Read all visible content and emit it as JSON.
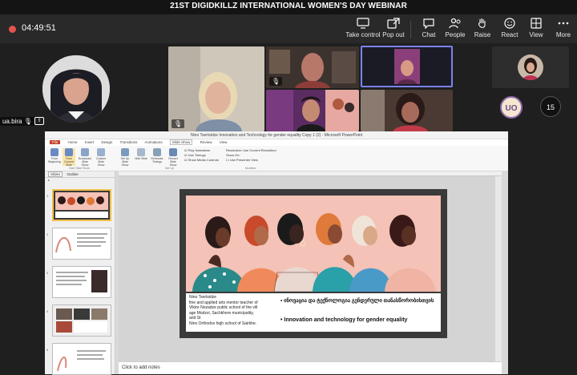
{
  "window": {
    "title": "21ST DIGIDKILLZ INTERNATIONAL WOMEN'S DAY WEBINAR"
  },
  "meeting": {
    "timer": "04:49:51",
    "toolbar": [
      {
        "id": "take-control",
        "label": "Take control",
        "icon": "monitor-icon"
      },
      {
        "id": "pop-out",
        "label": "Pop out",
        "icon": "pop-out-icon"
      },
      {
        "id": "chat",
        "label": "Chat",
        "icon": "chat-icon"
      },
      {
        "id": "people",
        "label": "People",
        "icon": "people-icon"
      },
      {
        "id": "raise",
        "label": "Raise",
        "icon": "hand-icon"
      },
      {
        "id": "react",
        "label": "React",
        "icon": "smile-icon"
      },
      {
        "id": "view",
        "label": "View",
        "icon": "grid-icon"
      },
      {
        "id": "more",
        "label": "More",
        "icon": "more-icon"
      }
    ],
    "participants": {
      "presenter_name": "ua.bira",
      "initials_badge": "UO",
      "overflow_count": "15"
    }
  },
  "powerpoint": {
    "window_title": "Nino Tsertsidze Innovation and Technology for gender equality Copy 1 (2) - Microsoft PowerPoint",
    "tabs": [
      "File",
      "Home",
      "Insert",
      "Design",
      "Transitions",
      "Animations",
      "Slide Show",
      "Review",
      "View"
    ],
    "ribbon_buttons": [
      "From Beginning",
      "From Current Slide",
      "Broadcast Slide Show",
      "Custom Slide Show",
      "Set Up Slide Show",
      "Hide Slide",
      "Rehearse Timings",
      "Record Slide Show"
    ],
    "ribbon_checks": [
      "Play Narrations",
      "Use Timings",
      "Show Media Controls"
    ],
    "ribbon_selects": [
      "Resolution: Use Current Resolution",
      "Show On:",
      "Use Presenter View"
    ],
    "group_labels": [
      "Start Slide Show",
      "Set Up",
      "Monitors"
    ],
    "panel_tabs": [
      "Slides",
      "Outline"
    ],
    "notes_placeholder": "Click to add notes",
    "slide": {
      "caption_lines": [
        "Nino Tsertsidze",
        "fine and applied arts mentor teacher of",
        "Viktor Nozadze public school of the vill",
        "age Modzvi, Sachkhere municipality,",
        "and St",
        "Nino Orthodox high school of Sairkhe."
      ],
      "title_georgian": "ინოვაცია და ტექნოლოგია გენდერული თანასწორობისთვის",
      "title_english": "Innovation and technology for gender equality"
    }
  },
  "colors": {
    "teams_bg": "#1f1f1f",
    "toolbar_bg": "#292929",
    "record_red": "#e5534b",
    "slide_peach": "#f4c2b6",
    "thumb_selected": "#f0c04a"
  }
}
